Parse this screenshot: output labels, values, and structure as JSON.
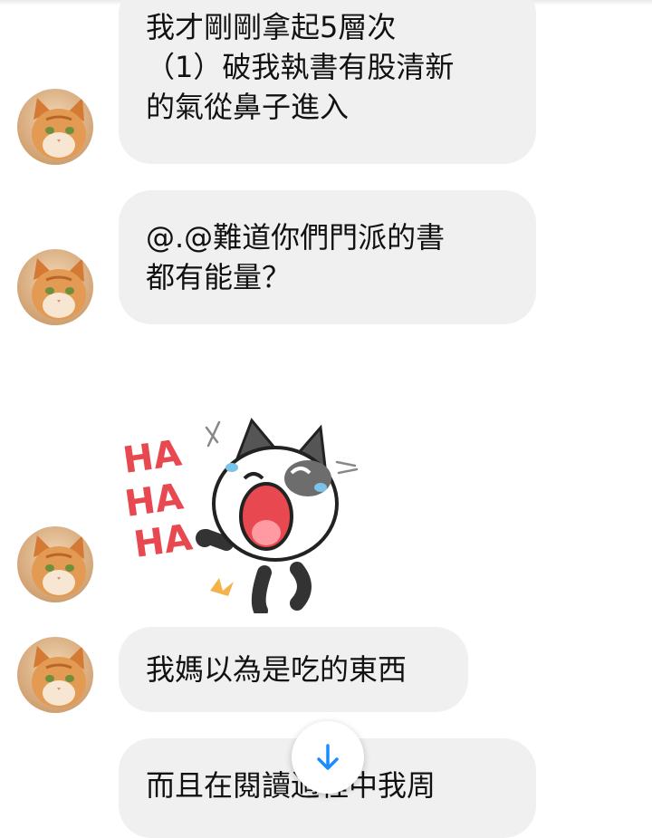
{
  "messages": [
    {
      "type": "text",
      "lines": [
        "我才剛剛拿起5層次",
        "（1）破我執書有股清新",
        "的氣從鼻子進入"
      ],
      "avatar_icon": "cat-avatar"
    },
    {
      "type": "text",
      "lines": [
        "@.@難道你們門派的書",
        "都有能量？"
      ],
      "avatar_icon": "cat-avatar"
    },
    {
      "type": "sticker",
      "sticker_text": [
        "HA",
        "HA",
        "HA"
      ],
      "avatar_icon": "cat-avatar"
    },
    {
      "type": "text",
      "lines": [
        "我媽以為是吃的東西"
      ],
      "avatar_icon": "cat-avatar"
    },
    {
      "type": "text",
      "lines": [
        "而且在閱讀過程中我周"
      ],
      "avatar_icon": "cat-avatar"
    }
  ],
  "scroll_button": {
    "icon": "arrow-down-icon"
  },
  "colors": {
    "bubble": "#f0f0f0",
    "text": "#111111",
    "accent": "#1a8cff",
    "sticker_red": "#e8484f"
  }
}
